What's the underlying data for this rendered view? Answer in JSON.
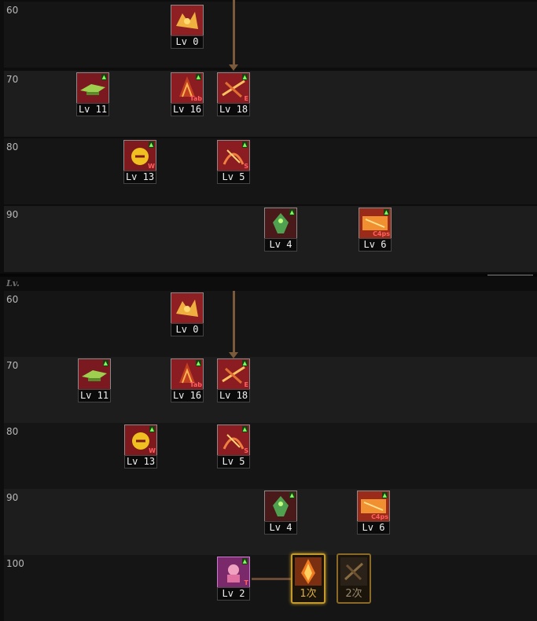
{
  "header": {
    "lv_label": "Lv."
  },
  "rows": [
    "60",
    "70",
    "80",
    "90",
    "100"
  ],
  "skills": [
    {
      "lv": "Lv 0",
      "tag": ""
    },
    {
      "lv": "Lv 11",
      "tag": ""
    },
    {
      "lv": "Lv 16",
      "tag": "Tab"
    },
    {
      "lv": "Lv 18",
      "tag": "E"
    },
    {
      "lv": "Lv 13",
      "tag": "W"
    },
    {
      "lv": "Lv 5",
      "tag": "S"
    },
    {
      "lv": "Lv 4",
      "tag": ""
    },
    {
      "lv": "Lv 6",
      "tag": "C4ps"
    },
    {
      "lv": "Lv 2",
      "tag": "T"
    }
  ],
  "awakening": {
    "first": "1次",
    "second": "2次"
  },
  "colors": {
    "accent_gold": "#c49a2a",
    "connector": "#7a5a3a",
    "req_green": "#7cff5a",
    "icon_red": "#a1262a",
    "icon_purple": "#b04fb0"
  }
}
